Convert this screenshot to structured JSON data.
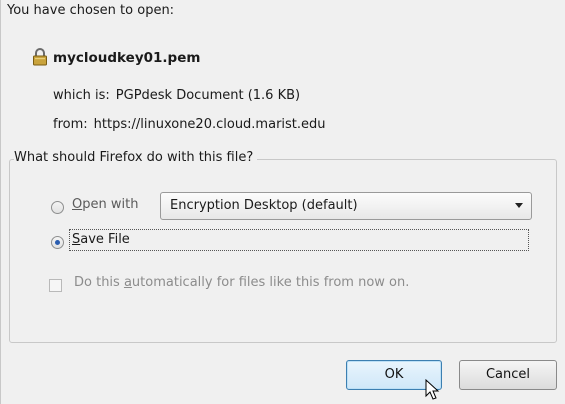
{
  "dialog": {
    "heading": "You have chosen to open:",
    "file_name": "mycloudkey01.pem",
    "which_label": "which is:",
    "which_value": "PGPdesk Document (1.6 KB)",
    "from_label": "from:",
    "from_value": "https://linuxone20.cloud.marist.edu",
    "group_legend": "What should Firefox do with this file?",
    "open_with": {
      "mnemonic": "O",
      "rest": "pen with",
      "selected": false
    },
    "app_select": {
      "value": "Encryption Desktop (default)"
    },
    "save_file": {
      "mnemonic": "S",
      "rest": "ave File",
      "selected": true
    },
    "auto_checkbox": {
      "before": "Do this ",
      "mnemonic": "a",
      "after": "utomatically for files like this from now on.",
      "checked": false,
      "enabled": false
    },
    "ok_label": "OK",
    "cancel_label": "Cancel"
  },
  "icons": {
    "file": "lock-icon",
    "cursor": "mouse-pointer-icon"
  },
  "colors": {
    "background": "#f0f0f0",
    "radio_selected": "#2a5db0",
    "ok_border": "#3c7fb1",
    "disabled_text": "#8c8c8c"
  }
}
